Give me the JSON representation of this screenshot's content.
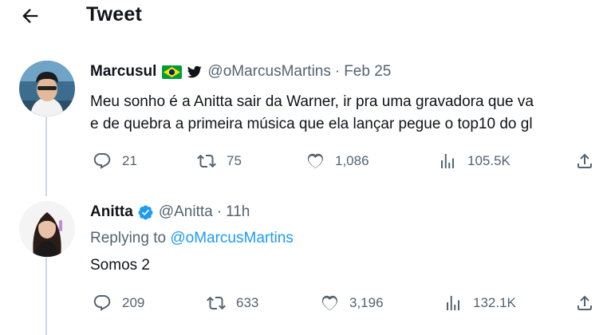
{
  "header": {
    "title": "Tweet"
  },
  "tweets": [
    {
      "name": "Marcusul",
      "handle": "@oMarcusMartins",
      "time": "Feb 25",
      "text_lines": [
        "Meu sonho é a Anitta sair da Warner, ir pra uma gravadora que va",
        "e de quebra a primeira música que ela lançar pegue o top10 do gl"
      ],
      "replies": "21",
      "retweets": "75",
      "likes": "1,086",
      "views": "105.5K"
    },
    {
      "name": "Anitta",
      "handle": "@Anitta",
      "time": "11h",
      "replying_prefix": "Replying to",
      "replying_to": "@oMarcusMartins",
      "text": "Somos 2",
      "replies": "209",
      "retweets": "633",
      "likes": "3,196",
      "views": "132.1K"
    }
  ],
  "separator": "·",
  "icons": {
    "back": "arrow-left-icon",
    "flag": "brazil-flag-icon",
    "twitter": "twitter-bird-icon",
    "verified": "verified-badge-icon",
    "reply": "reply-icon",
    "retweet": "retweet-icon",
    "like": "heart-icon",
    "views": "views-icon",
    "share": "share-icon"
  },
  "colors": {
    "text": "#0f1419",
    "secondary": "#536471",
    "link": "#1d9bf0",
    "thread_line": "#cfd9de",
    "verified": "#1d9bf0",
    "flag_green": "#009c3b",
    "flag_yellow": "#ffdf00",
    "flag_blue": "#002776"
  }
}
